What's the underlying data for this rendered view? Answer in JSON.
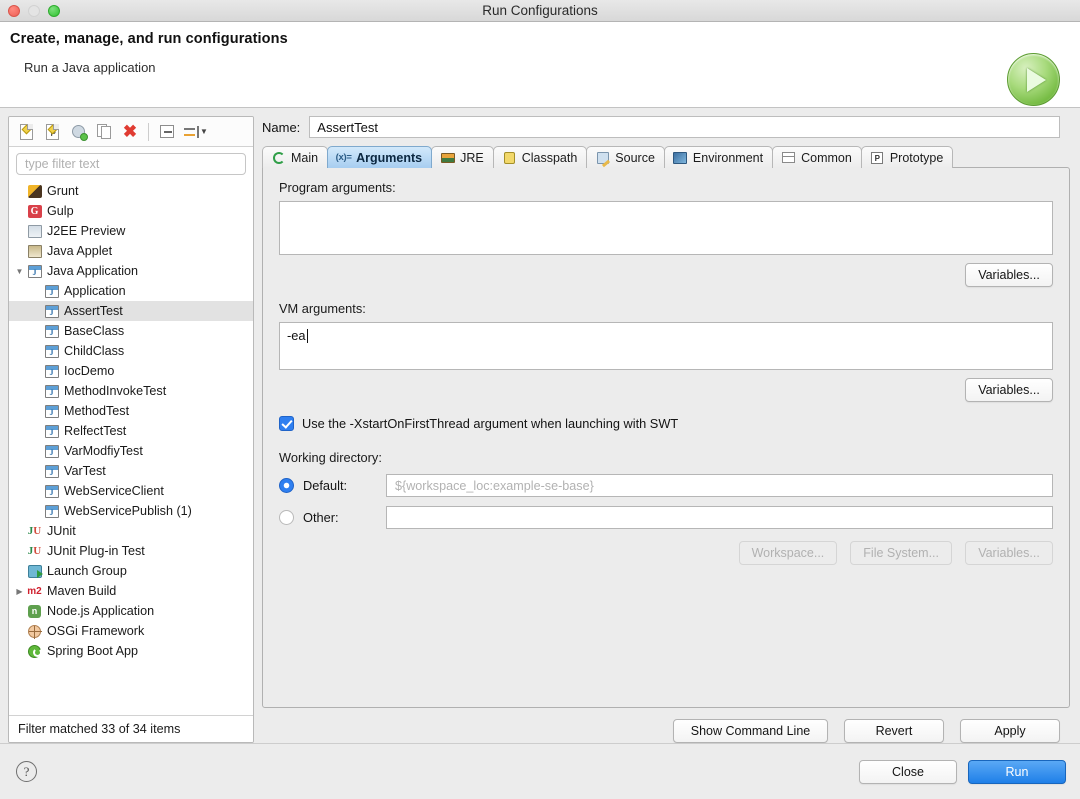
{
  "window": {
    "title": "Run Configurations",
    "controls": [
      "close-light",
      "minimize-light",
      "maximize-light"
    ]
  },
  "banner": {
    "heading": "Create, manage, and run configurations",
    "subheading": "Run a Java application",
    "icon": "run-play-icon"
  },
  "left_panel": {
    "toolbar": [
      {
        "name": "new-configuration-icon",
        "tooltip": "New launch configuration"
      },
      {
        "name": "new-prototype-icon",
        "tooltip": "New prototype"
      },
      {
        "name": "export-configuration-icon",
        "tooltip": "Export"
      },
      {
        "name": "duplicate-configuration-icon",
        "tooltip": "Duplicate"
      },
      {
        "name": "delete-configuration-icon",
        "tooltip": "Delete"
      },
      {
        "name": "collapse-all-icon",
        "tooltip": "Collapse All"
      },
      {
        "name": "filter-launch-configurations-icon",
        "tooltip": "Filter"
      }
    ],
    "filter": {
      "placeholder": "type filter text",
      "value": ""
    },
    "tree": [
      {
        "label": "Grunt",
        "icon": "grunt-icon",
        "indent": 0,
        "twisty": "",
        "selected": false
      },
      {
        "label": "Gulp",
        "icon": "gulp-icon",
        "indent": 0,
        "twisty": "",
        "selected": false
      },
      {
        "label": "J2EE Preview",
        "icon": "j2ee-icon",
        "indent": 0,
        "twisty": "",
        "selected": false
      },
      {
        "label": "Java Applet",
        "icon": "java-applet-icon",
        "indent": 0,
        "twisty": "",
        "selected": false
      },
      {
        "label": "Java Application",
        "icon": "java-icon",
        "indent": 0,
        "twisty": "▼",
        "selected": false
      },
      {
        "label": "Application",
        "icon": "java-icon",
        "indent": 1,
        "twisty": "",
        "selected": false
      },
      {
        "label": "AssertTest",
        "icon": "java-icon",
        "indent": 1,
        "twisty": "",
        "selected": true
      },
      {
        "label": "BaseClass",
        "icon": "java-icon",
        "indent": 1,
        "twisty": "",
        "selected": false
      },
      {
        "label": "ChildClass",
        "icon": "java-icon",
        "indent": 1,
        "twisty": "",
        "selected": false
      },
      {
        "label": "IocDemo",
        "icon": "java-icon",
        "indent": 1,
        "twisty": "",
        "selected": false
      },
      {
        "label": "MethodInvokeTest",
        "icon": "java-icon",
        "indent": 1,
        "twisty": "",
        "selected": false
      },
      {
        "label": "MethodTest",
        "icon": "java-icon",
        "indent": 1,
        "twisty": "",
        "selected": false
      },
      {
        "label": "RelfectTest",
        "icon": "java-icon",
        "indent": 1,
        "twisty": "",
        "selected": false
      },
      {
        "label": "VarModfiyTest",
        "icon": "java-icon",
        "indent": 1,
        "twisty": "",
        "selected": false
      },
      {
        "label": "VarTest",
        "icon": "java-icon",
        "indent": 1,
        "twisty": "",
        "selected": false
      },
      {
        "label": "WebServiceClient",
        "icon": "java-icon",
        "indent": 1,
        "twisty": "",
        "selected": false
      },
      {
        "label": "WebServicePublish (1)",
        "icon": "java-icon",
        "indent": 1,
        "twisty": "",
        "selected": false
      },
      {
        "label": "JUnit",
        "icon": "junit-icon",
        "indent": 0,
        "twisty": "",
        "selected": false
      },
      {
        "label": "JUnit Plug-in Test",
        "icon": "junit-plugin-icon",
        "indent": 0,
        "twisty": "",
        "selected": false
      },
      {
        "label": "Launch Group",
        "icon": "launch-group-icon",
        "indent": 0,
        "twisty": "",
        "selected": false
      },
      {
        "label": "Maven Build",
        "icon": "maven-icon",
        "indent": 0,
        "twisty": "▶",
        "selected": false
      },
      {
        "label": "Node.js Application",
        "icon": "nodejs-icon",
        "indent": 0,
        "twisty": "",
        "selected": false
      },
      {
        "label": "OSGi Framework",
        "icon": "osgi-icon",
        "indent": 0,
        "twisty": "",
        "selected": false
      },
      {
        "label": "Spring Boot App",
        "icon": "spring-boot-icon",
        "indent": 0,
        "twisty": "",
        "selected": false
      }
    ],
    "status": "Filter matched 33 of 34 items"
  },
  "right_panel": {
    "name_label": "Name:",
    "name_value": "AssertTest",
    "tabs": [
      {
        "label": "Main",
        "icon": "main-tab-icon",
        "active": false
      },
      {
        "label": "Arguments",
        "icon": "arguments-tab-icon",
        "active": true
      },
      {
        "label": "JRE",
        "icon": "jre-tab-icon",
        "active": false
      },
      {
        "label": "Classpath",
        "icon": "classpath-tab-icon",
        "active": false
      },
      {
        "label": "Source",
        "icon": "source-tab-icon",
        "active": false
      },
      {
        "label": "Environment",
        "icon": "environment-tab-icon",
        "active": false
      },
      {
        "label": "Common",
        "icon": "common-tab-icon",
        "active": false
      },
      {
        "label": "Prototype",
        "icon": "prototype-tab-icon",
        "active": false
      }
    ],
    "program_arguments": {
      "label": "Program arguments:",
      "value": "",
      "variables_button": "Variables..."
    },
    "vm_arguments": {
      "label": "VM arguments:",
      "value": "-ea",
      "variables_button": "Variables..."
    },
    "swt_checkbox": {
      "label": "Use the -XstartOnFirstThread argument when launching with SWT",
      "checked": true
    },
    "working_directory": {
      "label": "Working directory:",
      "default_radio_label": "Default:",
      "default_value": "${workspace_loc:example-se-base}",
      "other_radio_label": "Other:",
      "other_value": "",
      "selected": "default",
      "buttons": [
        "Workspace...",
        "File System...",
        "Variables..."
      ]
    },
    "actions": [
      "Show Command Line",
      "Revert",
      "Apply"
    ]
  },
  "footer": {
    "help_icon": "help-icon",
    "help_glyph": "?",
    "close_label": "Close",
    "run_label": "Run"
  },
  "colors": {
    "accent_blue": "#2f7ff0",
    "run_button": "#1f7fe8",
    "active_tab": "#a7cdf0",
    "selection_gray": "#e2e2e2",
    "play_green": "#72b93f",
    "delete_red": "#e03b32"
  }
}
